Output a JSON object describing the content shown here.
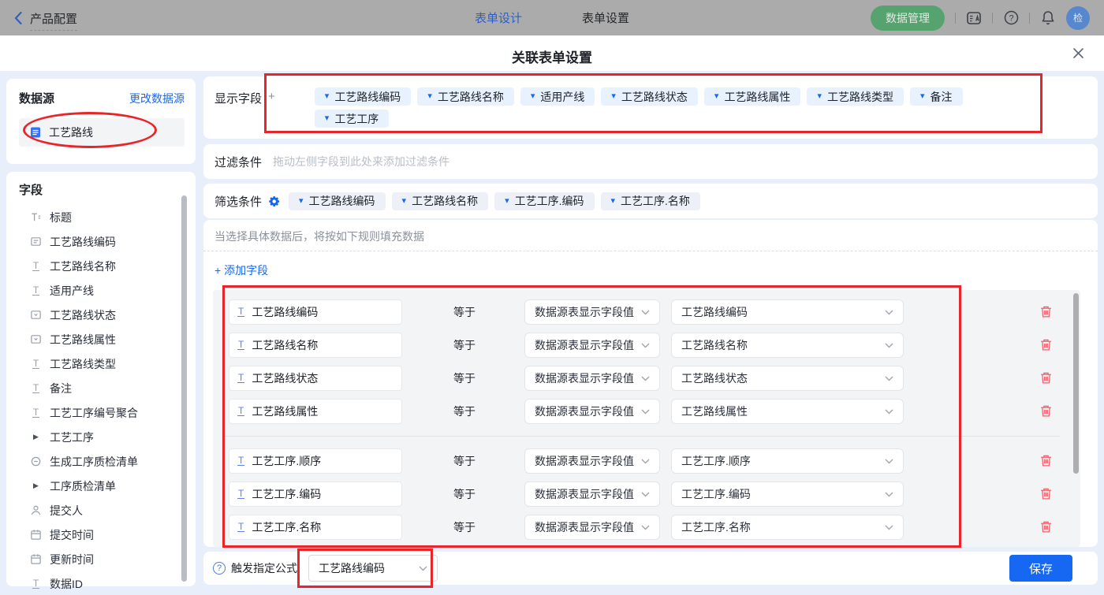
{
  "topbar": {
    "back_label": "产品配置",
    "tabs": [
      {
        "label": "表单设计",
        "active": true
      },
      {
        "label": "表单设置",
        "active": false
      }
    ],
    "data_manage_label": "数据管理",
    "avatar_text": "检"
  },
  "modal": {
    "title": "关联表单设置"
  },
  "sidebar": {
    "datasource": {
      "title": "数据源",
      "change_link": "更改数据源",
      "selected_item": "工艺路线"
    },
    "fields": {
      "title": "字段",
      "items": [
        {
          "label": "标题",
          "icon": "title-icon"
        },
        {
          "label": "工艺路线编码",
          "icon": "serial-icon"
        },
        {
          "label": "工艺路线名称",
          "icon": "text-icon"
        },
        {
          "label": "适用产线",
          "icon": "text-icon"
        },
        {
          "label": "工艺路线状态",
          "icon": "select-icon"
        },
        {
          "label": "工艺路线属性",
          "icon": "select-icon"
        },
        {
          "label": "工艺路线类型",
          "icon": "text-icon"
        },
        {
          "label": "备注",
          "icon": "text-icon"
        },
        {
          "label": "工艺工序编号聚合",
          "icon": "text-icon"
        },
        {
          "label": "工艺工序",
          "icon": "expand-icon"
        },
        {
          "label": "生成工序质检清单",
          "icon": "toggle-icon"
        },
        {
          "label": "工序质检清单",
          "icon": "expand-icon"
        },
        {
          "label": "提交人",
          "icon": "person-icon"
        },
        {
          "label": "提交时间",
          "icon": "calendar-icon"
        },
        {
          "label": "更新时间",
          "icon": "calendar-icon"
        },
        {
          "label": "数据ID",
          "icon": "text-icon"
        }
      ]
    }
  },
  "main": {
    "display": {
      "label": "显示字段",
      "plus": "+",
      "tags1": [
        "工艺路线编码",
        "工艺路线名称",
        "适用产线",
        "工艺路线状态",
        "工艺路线属性",
        "工艺路线类型",
        "备注"
      ],
      "tags2": [
        "工艺工序"
      ]
    },
    "filter": {
      "label": "过滤条件",
      "placeholder": "拖动左侧字段到此处来添加过滤条件"
    },
    "screen": {
      "label": "筛选条件",
      "tags": [
        "工艺路线编码",
        "工艺路线名称",
        "工艺工序.编码",
        "工艺工序.名称"
      ]
    },
    "rules": {
      "hint": "当选择具体数据后，将按如下规则填充数据",
      "add_label": "添加字段",
      "operator": "等于",
      "source_value": "数据源表显示字段值",
      "group1": [
        {
          "field": "工艺路线编码",
          "target": "工艺路线编码"
        },
        {
          "field": "工艺路线名称",
          "target": "工艺路线名称"
        },
        {
          "field": "工艺路线状态",
          "target": "工艺路线状态"
        },
        {
          "field": "工艺路线属性",
          "target": "工艺路线属性"
        }
      ],
      "group2": [
        {
          "field": "工艺工序.顺序",
          "target": "工艺工序.顺序"
        },
        {
          "field": "工艺工序.编码",
          "target": "工艺工序.编码"
        },
        {
          "field": "工艺工序.名称",
          "target": "工艺工序.名称"
        }
      ]
    },
    "footer": {
      "trigger_label": "触发指定公式",
      "trigger_value": "工艺路线编码",
      "save_label": "保存"
    }
  },
  "colors": {
    "accent_blue": "#1668f2",
    "annotation_red": "#e8252a",
    "tag_blue_bg": "#e7f2fe",
    "tag_gray_bg": "#edf0f6",
    "green_pill": "#57a36f",
    "trash_red": "#f2606e",
    "modal_body_bg": "#e9effa"
  }
}
